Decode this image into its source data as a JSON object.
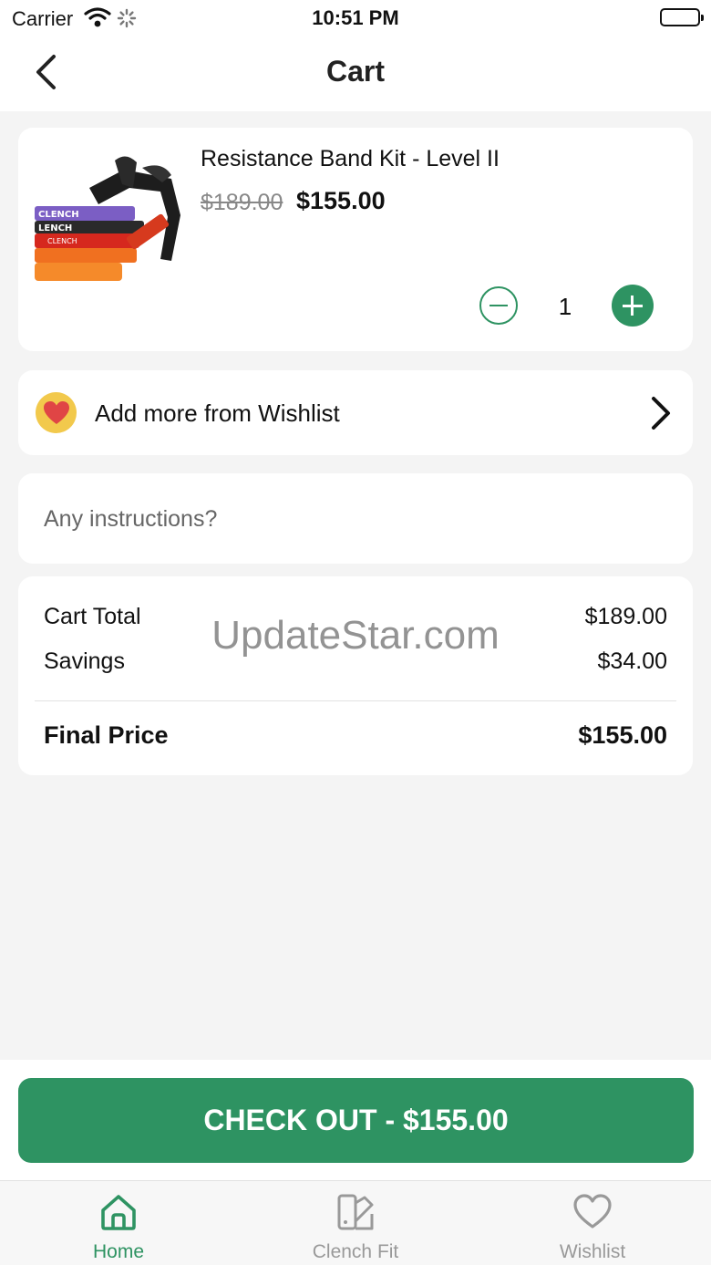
{
  "status_bar": {
    "carrier": "Carrier",
    "time": "10:51 PM"
  },
  "nav": {
    "title": "Cart"
  },
  "cart_item": {
    "name": "Resistance Band Kit - Level II",
    "original_price": "$189.00",
    "sale_price": "$155.00",
    "quantity": "1"
  },
  "wishlist_link": {
    "label": "Add more from Wishlist"
  },
  "instructions": {
    "placeholder": "Any instructions?",
    "value": ""
  },
  "summary": {
    "cart_total_label": "Cart Total",
    "cart_total_value": "$189.00",
    "savings_label": "Savings",
    "savings_value": "$34.00",
    "final_label": "Final Price",
    "final_value": "$155.00",
    "watermark": "UpdateStar.com"
  },
  "checkout": {
    "label": "CHECK OUT - $155.00"
  },
  "tabs": [
    {
      "label": "Home",
      "icon": "home-icon",
      "active": true
    },
    {
      "label": "Clench Fit",
      "icon": "clench-fit-icon",
      "active": false
    },
    {
      "label": "Wishlist",
      "icon": "heart-icon",
      "active": false
    }
  ],
  "colors": {
    "accent": "#2e9362",
    "background": "#f4f4f4",
    "inactive_tab": "#999999"
  }
}
